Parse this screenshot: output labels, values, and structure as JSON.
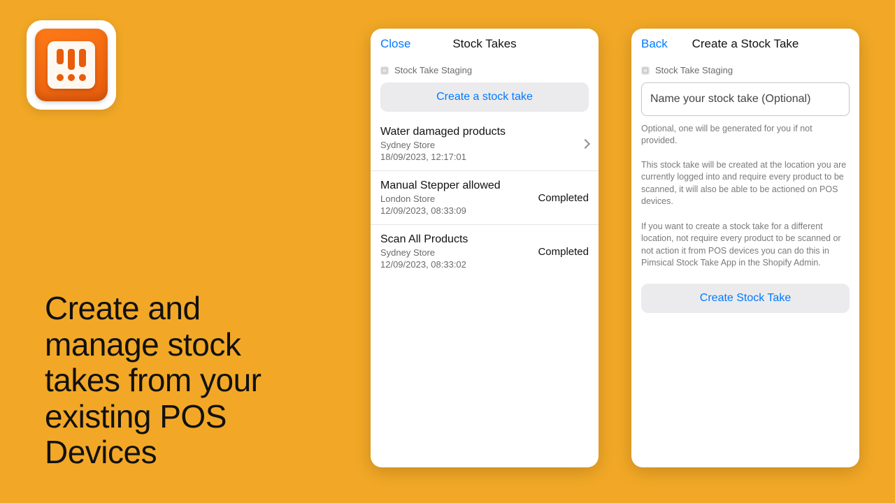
{
  "promo": {
    "headline": "Create and manage stock takes from your existing POS Devices"
  },
  "panel1": {
    "nav_left": "Close",
    "nav_title": "Stock Takes",
    "staging_label": "Stock Take Staging",
    "create_button": "Create a stock take",
    "stocktakes": [
      {
        "title": "Water damaged products",
        "store": "Sydney Store",
        "timestamp": "18/09/2023, 12:17:01",
        "status": "",
        "has_chevron": true
      },
      {
        "title": "Manual Stepper allowed",
        "store": "London Store",
        "timestamp": "12/09/2023, 08:33:09",
        "status": "Completed",
        "has_chevron": false
      },
      {
        "title": "Scan All Products",
        "store": "Sydney Store",
        "timestamp": "12/09/2023, 08:33:02",
        "status": "Completed",
        "has_chevron": false
      }
    ]
  },
  "panel2": {
    "nav_left": "Back",
    "nav_title": "Create a Stock Take",
    "staging_label": "Stock Take Staging",
    "name_placeholder": "Name your stock take (Optional)",
    "name_hint": "Optional, one will be generated for you if not provided.",
    "info_para_1": "This stock take will be created at the location you are currently logged into and require every product to be scanned, it will also be able to be actioned on POS devices.",
    "info_para_2": "If you want to create a stock take for a different location, not require every product to be scanned or not action it from POS devices you can do this in Pimsical Stock Take App in the Shopify Admin.",
    "submit_button": "Create Stock Take"
  }
}
